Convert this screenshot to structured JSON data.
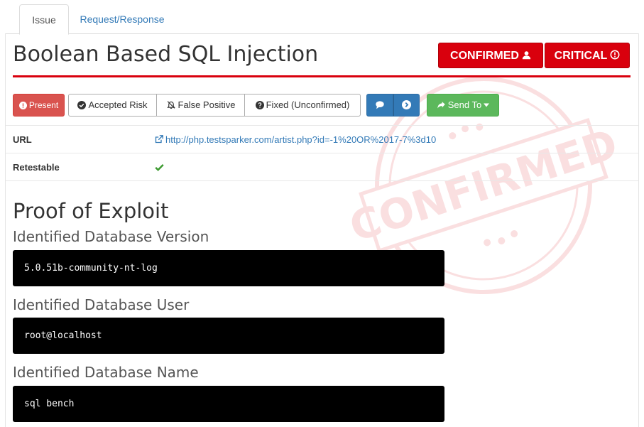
{
  "tabs": [
    {
      "label": "Issue",
      "active": true
    },
    {
      "label": "Request/Response",
      "active": false
    }
  ],
  "issue": {
    "title": "Boolean Based SQL Injection",
    "status_badge": "CONFIRMED",
    "severity_badge": "CRITICAL"
  },
  "toolbar": {
    "present_label": "Present",
    "accepted_risk_label": "Accepted Risk",
    "false_positive_label": "False Positive",
    "fixed_label": "Fixed (Unconfirmed)",
    "send_to_label": "Send To"
  },
  "details": {
    "url_label": "URL",
    "url_value": "http://php.testsparker.com/artist.php?id=-1%20OR%2017-7%3d10",
    "retestable_label": "Retestable"
  },
  "proof": {
    "heading": "Proof of Exploit",
    "items": [
      {
        "label": "Identified Database Version",
        "value": "5.0.51b-community-nt-log"
      },
      {
        "label": "Identified Database User",
        "value": "root@localhost"
      },
      {
        "label": "Identified Database Name",
        "value": "sql bench"
      }
    ]
  },
  "stamp": {
    "text": "CONFIRMED"
  },
  "colors": {
    "critical_red": "#d9000d",
    "present_red": "#d9534f",
    "primary_blue": "#337ab7",
    "success_green": "#5cb85c",
    "check_green": "#3c9a2f"
  },
  "icons": {
    "confirmed": "user-icon",
    "critical": "exclamation-circle-icon",
    "present": "exclamation-circle-icon",
    "accepted_risk": "check-circle-icon",
    "false_positive": "bell-slash-icon",
    "fixed": "question-circle-icon",
    "comment": "comment-icon",
    "forward": "arrow-circle-right-icon",
    "send_to": "share-icon",
    "url": "external-link-icon",
    "retestable": "check-icon"
  }
}
